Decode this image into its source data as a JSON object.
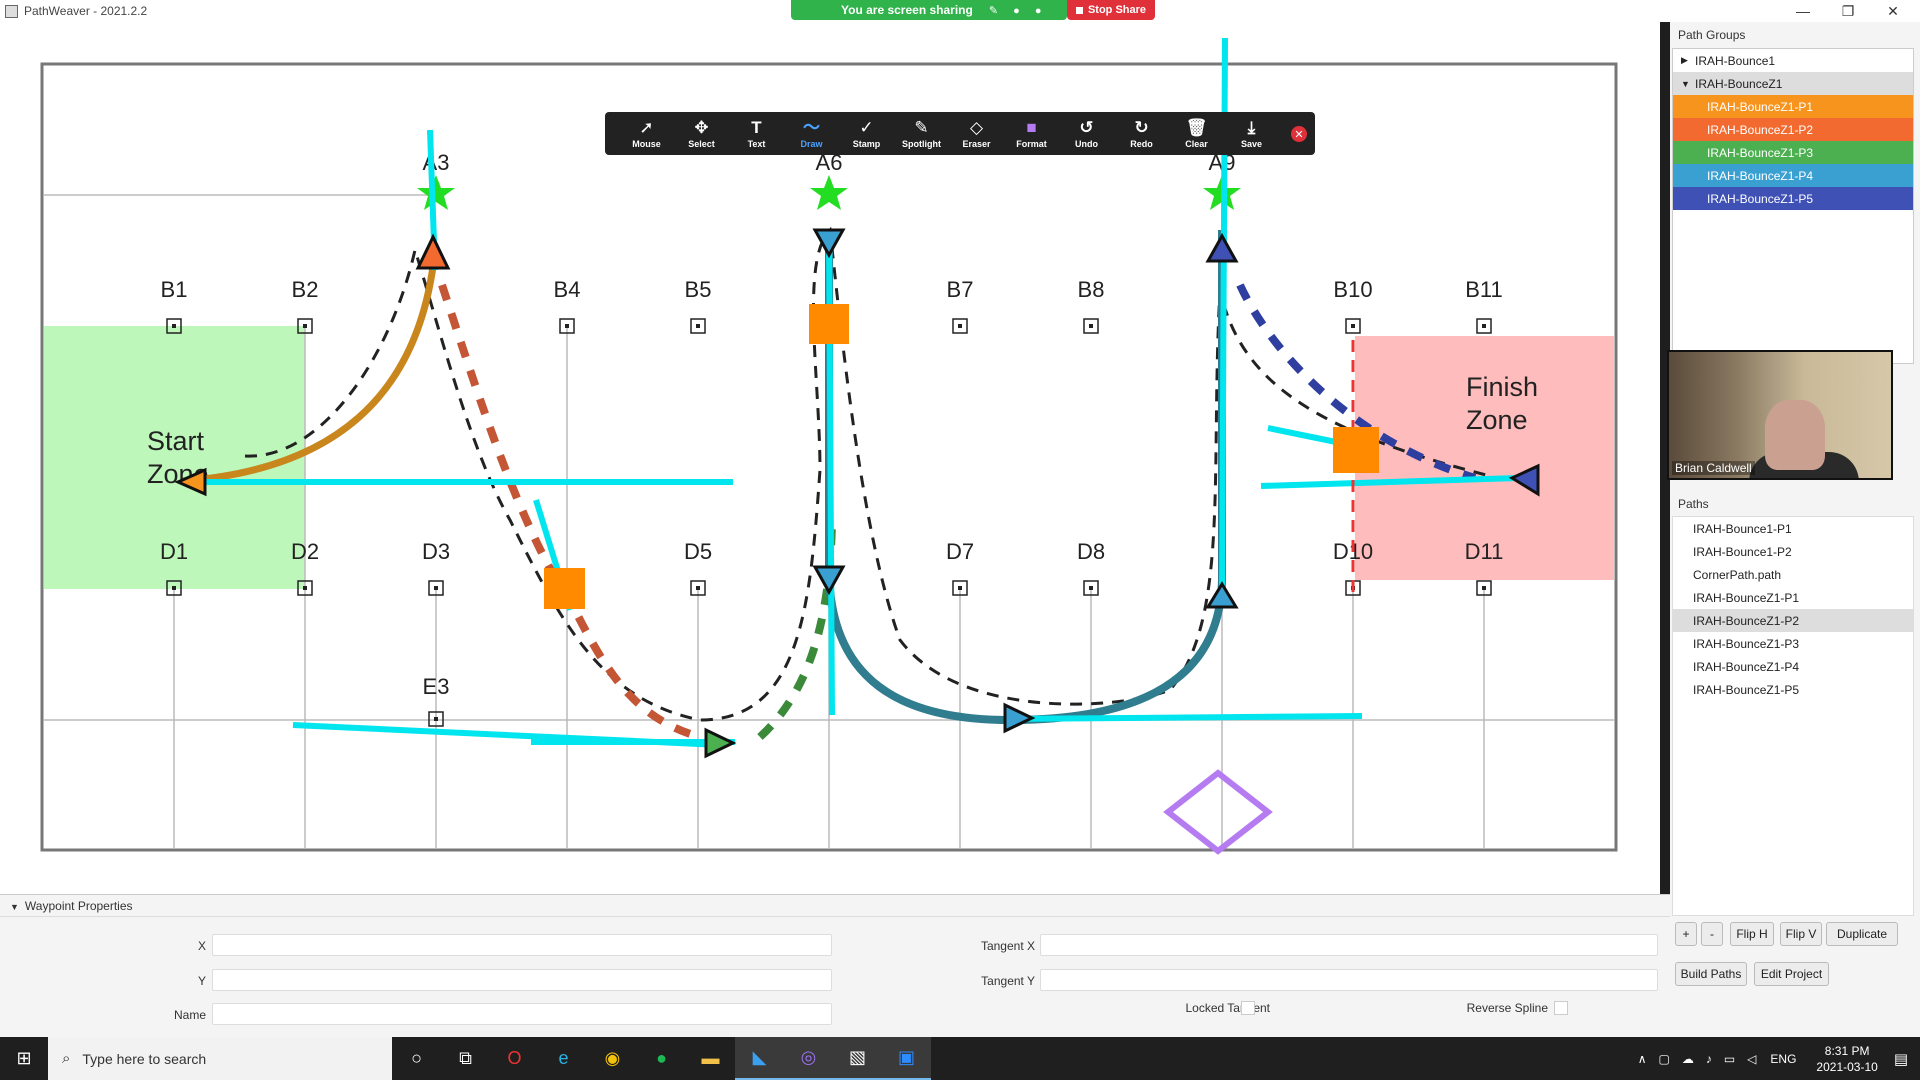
{
  "window": {
    "title": "PathWeaver - 2021.2.2",
    "minimize": "—",
    "maximize": "❐",
    "close": "✕"
  },
  "zoom": {
    "sharing_text": "You are screen sharing",
    "stop_share": "Stop Share",
    "tools": [
      {
        "label": "Mouse",
        "icon": "➚"
      },
      {
        "label": "Select",
        "icon": "✥"
      },
      {
        "label": "Text",
        "icon": "T"
      },
      {
        "label": "Draw",
        "icon": "〜"
      },
      {
        "label": "Stamp",
        "icon": "✓"
      },
      {
        "label": "Spotlight",
        "icon": "✎"
      },
      {
        "label": "Eraser",
        "icon": "◇"
      },
      {
        "label": "Format",
        "icon": "■"
      },
      {
        "label": "Undo",
        "icon": "↺"
      },
      {
        "label": "Redo",
        "icon": "↻"
      },
      {
        "label": "Clear",
        "icon": "🗑"
      },
      {
        "label": "Save",
        "icon": "⤓"
      }
    ],
    "close_icon": "✕"
  },
  "field": {
    "markers_top": [
      "A3",
      "A6",
      "A9"
    ],
    "markers_b": [
      "B1",
      "B2",
      "B4",
      "B5",
      "B7",
      "B8",
      "B10",
      "B11"
    ],
    "markers_d": [
      "D1",
      "D2",
      "D3",
      "D5",
      "D7",
      "D8",
      "D10",
      "D11"
    ],
    "marker_e": "E3",
    "start_zone_line1": "Start",
    "start_zone_line2": "Zone",
    "finish_zone_line1": "Finish",
    "finish_zone_line2": "Zone"
  },
  "path_groups": {
    "header": "Path Groups",
    "groups": [
      {
        "label": "IRAH-Bounce1",
        "expanded": false,
        "arrow": "▶"
      },
      {
        "label": "IRAH-BounceZ1",
        "expanded": true,
        "arrow": "▼"
      }
    ],
    "children": [
      {
        "label": "IRAH-BounceZ1-P1",
        "color": "#f7941d"
      },
      {
        "label": "IRAH-BounceZ1-P2",
        "color": "#f26a30"
      },
      {
        "label": "IRAH-BounceZ1-P3",
        "color": "#4caf50"
      },
      {
        "label": "IRAH-BounceZ1-P4",
        "color": "#3aa0d2"
      },
      {
        "label": "IRAH-BounceZ1-P5",
        "color": "#3f51b5"
      }
    ]
  },
  "video": {
    "name": "Brian Caldwell"
  },
  "paths": {
    "header": "Paths",
    "items": [
      {
        "label": "IRAH-Bounce1-P1",
        "selected": false
      },
      {
        "label": "IRAH-Bounce1-P2",
        "selected": false
      },
      {
        "label": "CornerPath.path",
        "selected": false
      },
      {
        "label": "IRAH-BounceZ1-P1",
        "selected": false
      },
      {
        "label": "IRAH-BounceZ1-P2",
        "selected": true
      },
      {
        "label": "IRAH-BounceZ1-P3",
        "selected": false
      },
      {
        "label": "IRAH-BounceZ1-P4",
        "selected": false
      },
      {
        "label": "IRAH-BounceZ1-P5",
        "selected": false
      }
    ]
  },
  "buttons": {
    "add": "+",
    "remove": "-",
    "flip_h": "Flip H",
    "flip_v": "Flip V",
    "duplicate": "Duplicate",
    "build_paths": "Build Paths",
    "edit_project": "Edit Project"
  },
  "waypoint": {
    "header": "Waypoint Properties",
    "header_arrow": "▼",
    "x": "X",
    "y": "Y",
    "name": "Name",
    "tangent_x": "Tangent X",
    "tangent_y": "Tangent Y",
    "locked_tangent": "Locked Tangent",
    "reverse_spline": "Reverse Spline"
  },
  "taskbar": {
    "search_placeholder": "Type here to search",
    "lang": "ENG",
    "time": "8:31 PM",
    "date": "2021-03-10"
  }
}
